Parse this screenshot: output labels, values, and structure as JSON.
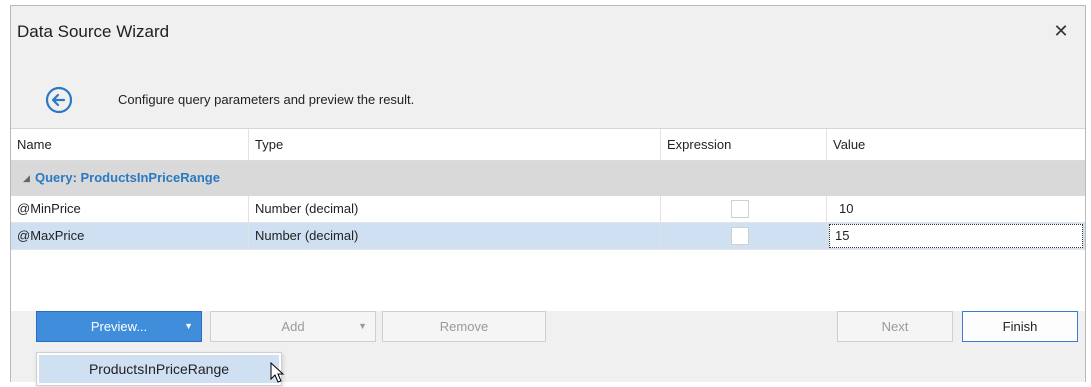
{
  "window": {
    "title": "Data Source Wizard",
    "close_icon": "close-icon"
  },
  "header": {
    "back_icon": "arrow-left-circle-icon",
    "text": "Configure query parameters and preview the result."
  },
  "grid": {
    "columns": [
      "Name",
      "Type",
      "Expression",
      "Value"
    ],
    "group_label": "Query: ProductsInPriceRange",
    "rows": [
      {
        "name": "@MinPrice",
        "type": "Number (decimal)",
        "expression": false,
        "value": "10"
      },
      {
        "name": "@MaxPrice",
        "type": "Number (decimal)",
        "expression": false,
        "value": "15"
      }
    ]
  },
  "footer": {
    "preview_label": "Preview...",
    "add_label": "Add",
    "remove_label": "Remove",
    "next_label": "Next",
    "finish_label": "Finish"
  },
  "dropdown": {
    "items": [
      "ProductsInPriceRange"
    ]
  },
  "colors": {
    "accent": "#2b79c2",
    "primary_button": "#3f8ddb",
    "selection": "#cfe0f3"
  }
}
